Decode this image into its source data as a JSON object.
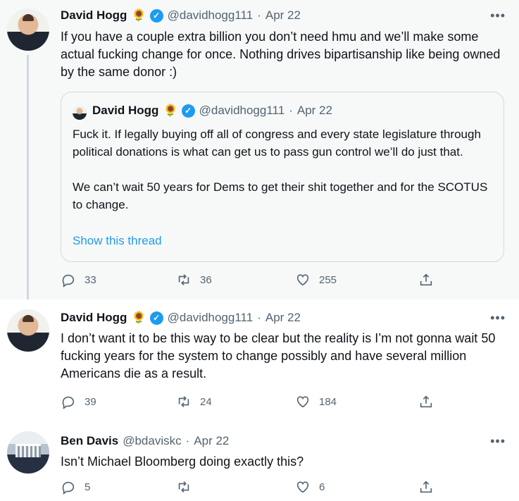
{
  "tweets": [
    {
      "author": "David Hogg",
      "emoji": "🌻",
      "verified": true,
      "handle": "@davidhogg111",
      "dot": "·",
      "date": "Apr 22",
      "text": "If you have a couple extra billion you don’t need hmu and we’ll make some actual fucking change for once. Nothing drives bipartisanship like being owned by the same donor :)",
      "quote": {
        "author": "David Hogg",
        "emoji": "🌻",
        "handle": "@davidhogg111",
        "dot": "·",
        "date": "Apr 22",
        "para1": "Fuck it. If legally buying off all of congress and every state legislature through political donations is what can get us to pass gun control we’ll do just that.",
        "para2": "We can’t wait 50 years for Dems to get their shit together and for the SCOTUS to change.",
        "link": "Show this thread"
      },
      "replies": "33",
      "retweets": "36",
      "likes": "255"
    },
    {
      "author": "David Hogg",
      "emoji": "🌻",
      "verified": true,
      "handle": "@davidhogg111",
      "dot": "·",
      "date": "Apr 22",
      "text": "I don’t want it to be this way to be clear but the reality is I’m not gonna wait 50 fucking years for the system to change possibly and have several million Americans die as a result.",
      "replies": "39",
      "retweets": "24",
      "likes": "184"
    },
    {
      "author": "Ben Davis",
      "handle": "@bdaviskc",
      "dot": "·",
      "date": "Apr 22",
      "text": "Isn’t Michael Bloomberg doing exactly this?",
      "replies": "5",
      "retweets": "",
      "likes": "6"
    }
  ],
  "more_label": "•••",
  "colors": {
    "accent": "#1d9bf0",
    "muted": "#536471",
    "highlight_bg": "#f7f9f9"
  },
  "icons": [
    "reply-icon",
    "retweet-icon",
    "like-icon",
    "share-icon",
    "verified-badge-icon",
    "more-icon"
  ]
}
